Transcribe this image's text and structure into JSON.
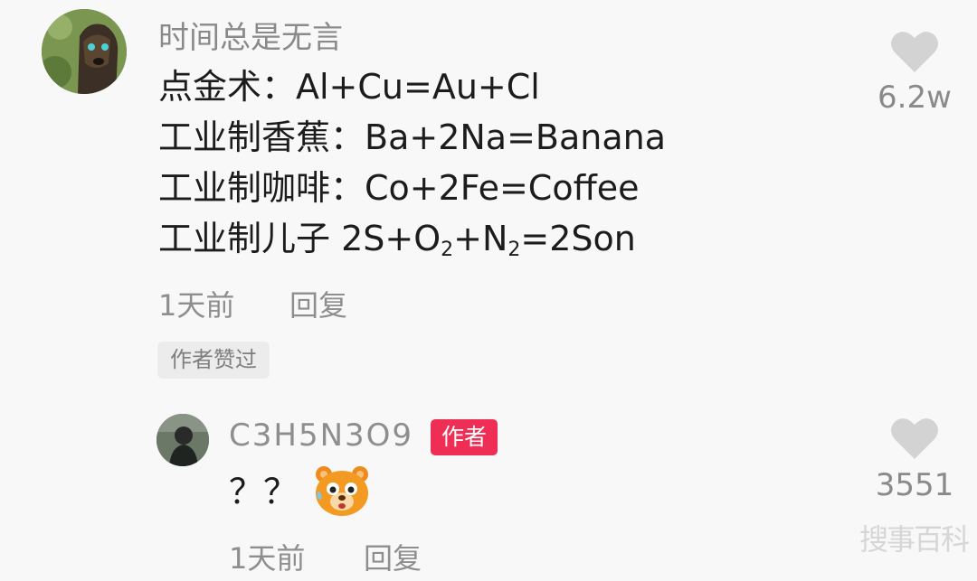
{
  "comment": {
    "username": "时间总是无言",
    "lines": [
      "点金术：Al+Cu=Au+Cl",
      "工业制香蕉：Ba+2Na=Banana",
      "工业制咖啡：Co+2Fe=Coffee"
    ],
    "line4": {
      "prefix": "工业制儿子 2S+O",
      "sub1": "2",
      "mid": "+N",
      "sub2": "2",
      "suffix": "=2Son"
    },
    "time": "1天前",
    "reply_label": "回复",
    "liked_badge": "作者赞过",
    "like_count": "6.2w"
  },
  "reply": {
    "username": "C3H5N3O9",
    "author_badge": "作者",
    "text": "？？",
    "emoji": "bear-emoji",
    "time": "1天前",
    "reply_label": "回复",
    "like_count": "3551"
  },
  "watermark": "搜事百科",
  "colors": {
    "author_badge_bg": "#ef2e55",
    "heart": "#d3d3d3",
    "meta_text": "#8e8e8e"
  }
}
